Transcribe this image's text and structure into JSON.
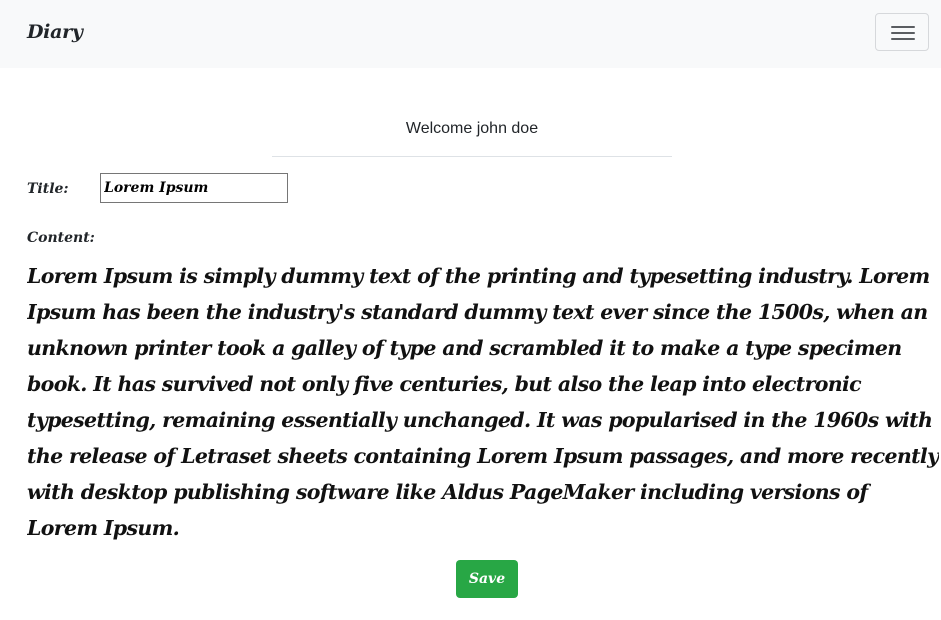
{
  "navbar": {
    "brand": "Diary",
    "toggler_icon": "hamburger-menu-icon",
    "background": "#f8f9fa"
  },
  "main": {
    "welcome": "Welcome john doe",
    "title_label": "Title:",
    "title_value": "Lorem Ipsum",
    "content_label": "Content:",
    "content_text": "Lorem Ipsum is simply dummy text of the printing and typesetting industry. Lorem Ipsum has been the industry's standard dummy text ever since the 1500s, when an unknown printer took a galley of type and scrambled it to make a type specimen book. It has survived not only five centuries, but also the leap into electronic typesetting, remaining essentially unchanged. It was popularised in the 1960s with the release of Letraset sheets containing Lorem Ipsum passages, and more recently with desktop publishing software like Aldus PageMaker including versions of Lorem Ipsum.",
    "save_label": "Save",
    "save_color": "#28a745"
  }
}
